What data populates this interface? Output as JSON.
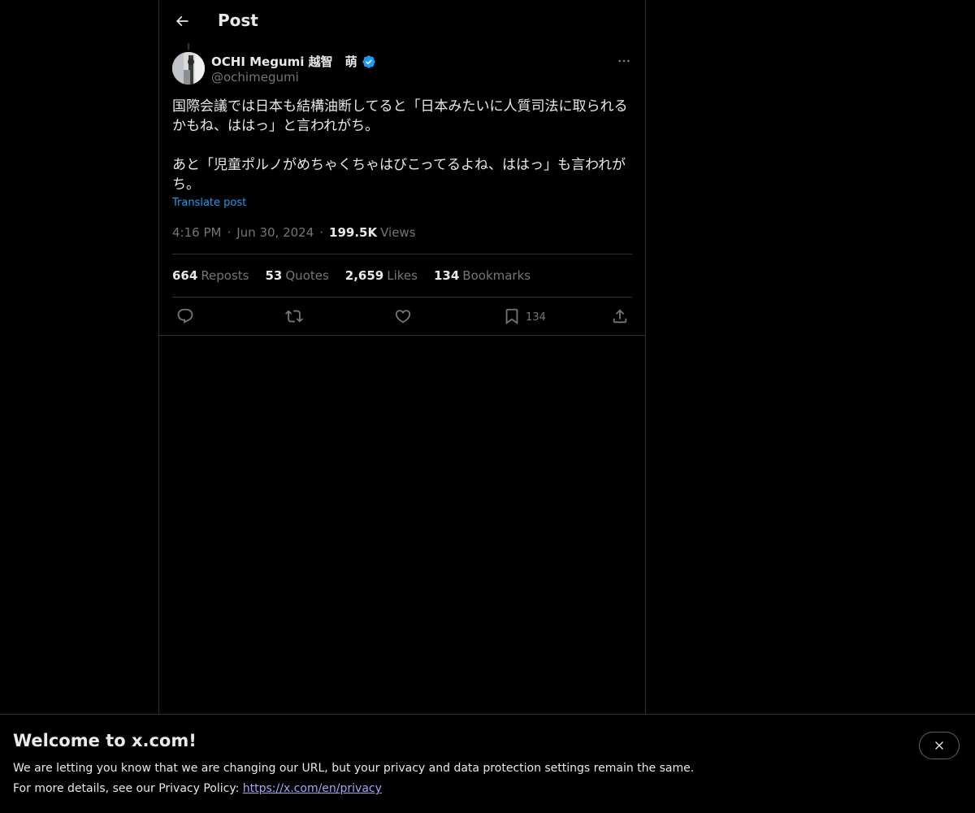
{
  "header": {
    "title": "Post"
  },
  "post": {
    "author_name": "OCHI Megumi 越智　萌",
    "author_handle": "@ochimegumi",
    "text": "国際会議では日本も結構油断してると「日本みたいに人質司法に取られるかもね、ははっ」と言われがち。\n\nあと「児童ポルノがめちゃくちゃはびこってるよね、ははっ」も言われがち。",
    "translate_label": "Translate post",
    "time": "4:16 PM",
    "date": "Jun 30, 2024",
    "views_count": "199.5K",
    "views_label": "Views"
  },
  "stats": {
    "reposts_count": "664",
    "reposts_label": "Reposts",
    "quotes_count": "53",
    "quotes_label": "Quotes",
    "likes_count": "2,659",
    "likes_label": "Likes",
    "bookmarks_count": "134",
    "bookmarks_label": "Bookmarks"
  },
  "actions": {
    "reply_icon": "reply-icon",
    "repost_icon": "repost-icon",
    "like_icon": "like-icon",
    "bookmark_icon": "bookmark-icon",
    "bookmark_count": "134",
    "share_icon": "share-icon"
  },
  "banner": {
    "title": "Welcome to x.com!",
    "line1": "We are letting you know that we are changing our URL, but your privacy and data protection settings remain the same.",
    "line2_prefix": "For more details, see our Privacy Policy: ",
    "link_text": "https://x.com/en/privacy"
  },
  "colors": {
    "background": "#000000",
    "text_primary": "#e7e9ea",
    "text_secondary": "#71767b",
    "accent": "#1d9bf0",
    "border": "#2f3336"
  }
}
